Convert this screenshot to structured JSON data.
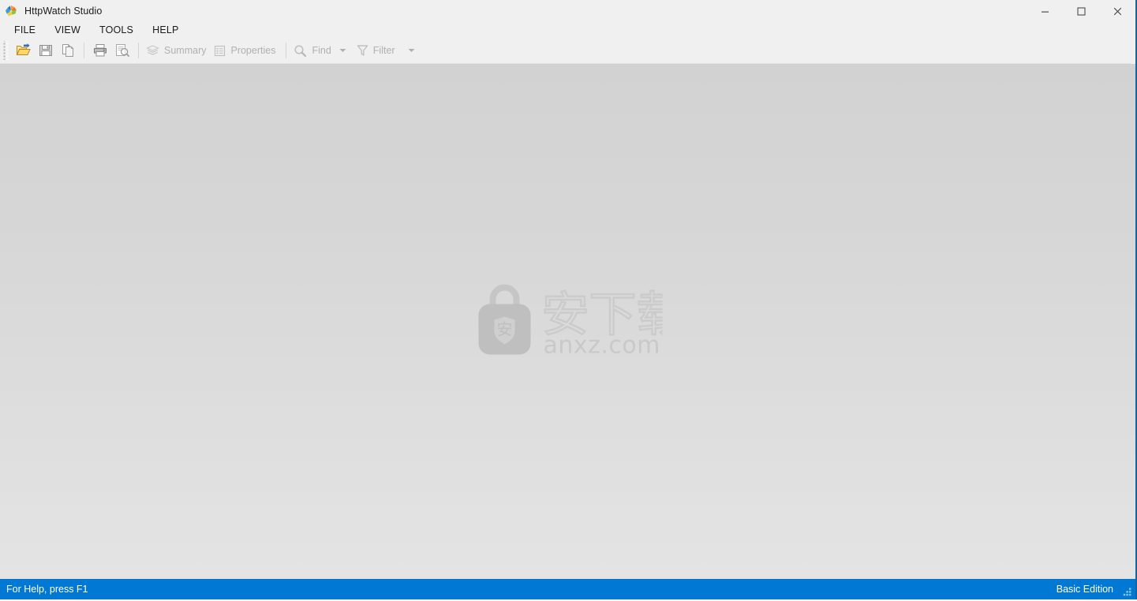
{
  "window": {
    "title": "HttpWatch Studio",
    "app_icon": "httpwatch-pinwheel-icon",
    "controls": {
      "minimize_label": "Minimize",
      "maximize_label": "Maximize",
      "close_label": "Close"
    }
  },
  "menu": {
    "items": [
      {
        "label": "FILE",
        "name": "menu-file"
      },
      {
        "label": "VIEW",
        "name": "menu-view"
      },
      {
        "label": "TOOLS",
        "name": "menu-tools"
      },
      {
        "label": "HELP",
        "name": "menu-help"
      }
    ]
  },
  "toolbar": {
    "open_label": "Open",
    "save_label": "Save",
    "copy_label": "Copy",
    "print_label": "Print",
    "print_preview_label": "Print Preview",
    "summary_label": "Summary",
    "properties_label": "Properties",
    "find_label": "Find",
    "filter_label": "Filter"
  },
  "client": {
    "watermark_text": "anxz.com",
    "watermark_cn_text": "安下载",
    "watermark_badge_text": "安"
  },
  "status": {
    "help_hint": "For Help, press F1",
    "edition": "Basic Edition"
  },
  "colors": {
    "accent": "#0078d4",
    "window_bg": "#f0f0f0",
    "client_top": "#d2d2d2",
    "client_bottom": "#e4e4e4",
    "border_right": "#1464a0",
    "disabled_text": "#b0b0b0",
    "watermark": "#c4c4c4"
  }
}
